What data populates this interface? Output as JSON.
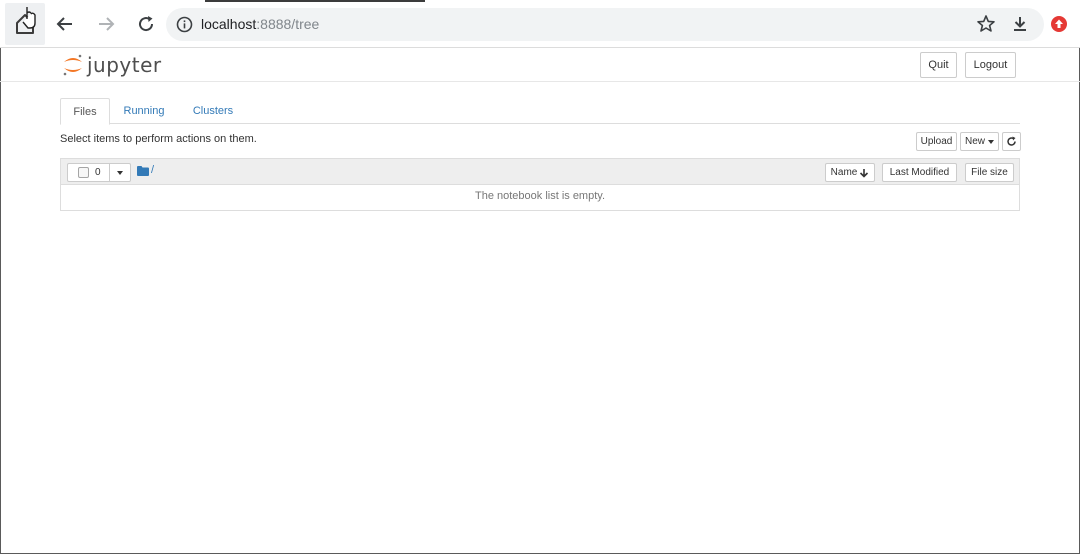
{
  "browser": {
    "url_host": "localhost",
    "url_rest": ":8888/tree"
  },
  "header": {
    "logo_text": "jupyter",
    "quit_label": "Quit",
    "logout_label": "Logout"
  },
  "tabs": [
    {
      "label": "Files",
      "active": true
    },
    {
      "label": "Running",
      "active": false
    },
    {
      "label": "Clusters",
      "active": false
    }
  ],
  "toolbar": {
    "hint": "Select items to perform actions on them.",
    "upload_label": "Upload",
    "new_label": "New"
  },
  "file_list": {
    "selected_count": "0",
    "path": "/",
    "columns": [
      "Name",
      "Last Modified",
      "File size"
    ],
    "empty_message": "The notebook list is empty."
  },
  "colors": {
    "link": "#337ab7",
    "jupyter_orange": "#f37726",
    "ext_red": "#e53935"
  }
}
